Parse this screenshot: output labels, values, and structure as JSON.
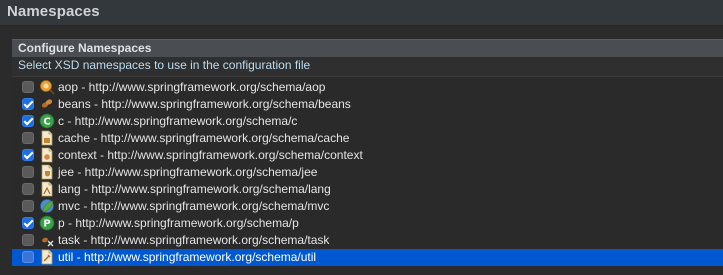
{
  "header": {
    "title": "Namespaces"
  },
  "section": {
    "title": "Configure Namespaces",
    "description": "Select XSD namespaces to use in the configuration file"
  },
  "colors": {
    "background": "#2b2b2b",
    "header_bg": "#33383c",
    "section_head_bg": "#4a4e52",
    "selection": "#0058d0",
    "checkbox_checked": "#1f6fe0",
    "description_text": "#b9dcf2"
  },
  "namespaces": [
    {
      "label": "aop - http://www.springframework.org/schema/aop",
      "checked": false,
      "icon": "aop-icon"
    },
    {
      "label": "beans - http://www.springframework.org/schema/beans",
      "checked": true,
      "icon": "beans-icon"
    },
    {
      "label": "c - http://www.springframework.org/schema/c",
      "checked": true,
      "icon": "c-namespace-icon"
    },
    {
      "label": "cache - http://www.springframework.org/schema/cache",
      "checked": false,
      "icon": "cache-icon"
    },
    {
      "label": "context - http://www.springframework.org/schema/context",
      "checked": true,
      "icon": "context-icon"
    },
    {
      "label": "jee - http://www.springframework.org/schema/jee",
      "checked": false,
      "icon": "jee-icon"
    },
    {
      "label": "lang - http://www.springframework.org/schema/lang",
      "checked": false,
      "icon": "lang-icon"
    },
    {
      "label": "mvc - http://www.springframework.org/schema/mvc",
      "checked": false,
      "icon": "mvc-icon"
    },
    {
      "label": "p - http://www.springframework.org/schema/p",
      "checked": true,
      "icon": "p-namespace-icon"
    },
    {
      "label": "task - http://www.springframework.org/schema/task",
      "checked": false,
      "icon": "task-icon"
    },
    {
      "label": "util - http://www.springframework.org/schema/util",
      "checked": false,
      "icon": "util-icon",
      "selected": true
    }
  ]
}
